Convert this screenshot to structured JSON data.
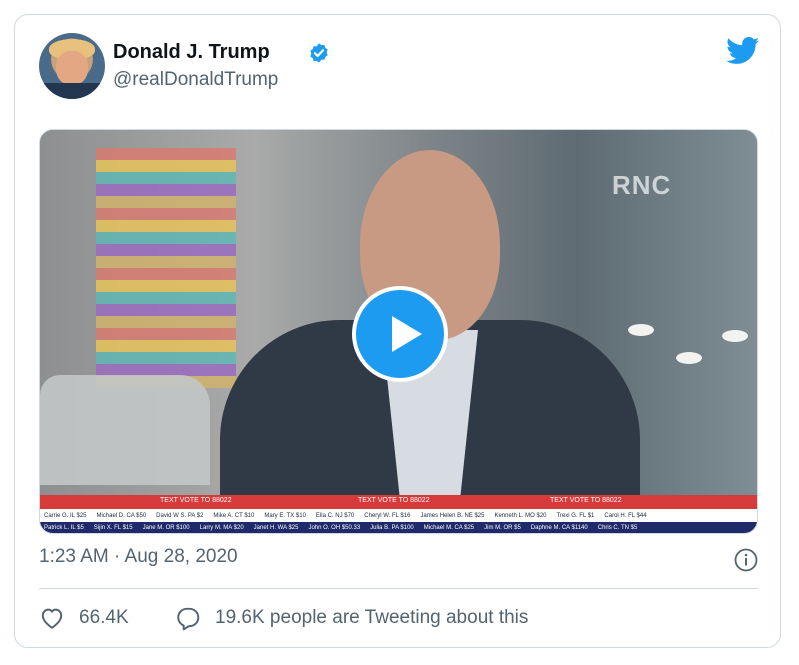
{
  "author": {
    "name": "Donald J. Trump",
    "handle": "@realDonaldTrump"
  },
  "icons": {
    "verified": "verified-badge-icon",
    "brand": "twitter-bird-icon",
    "play": "play-icon",
    "info": "info-icon",
    "like": "heart-icon",
    "reply": "speech-bubble-icon"
  },
  "media": {
    "watermark": "RNC",
    "ticker_banner": [
      "TEXT VOTE TO 88022",
      "TEXT VOTE TO 88022",
      "TEXT VOTE TO 88022"
    ],
    "ticker_row1": [
      "Carrie G. IL $25",
      "Michael D. CA $50",
      "David W S. PA $2",
      "Mike A. CT $10",
      "Mary E. TX $10",
      "Ella C. NJ $70",
      "Cheryl W. FL $16",
      "James Helen B. NE $25",
      "Kenneth L. MO $20",
      "Trexi G. FL $1",
      "Carol H. FL $44"
    ],
    "ticker_row2": [
      "Patrick L. IL $5",
      "Sijin X. FL $15",
      "Jane M. OR $100",
      "Larry M. MA $20",
      "Janet H. WA $25",
      "John O. OH $50.33",
      "Julia B. PA $100",
      "Michael M. CA $25",
      "Jim M. OR $5",
      "Daphne M. CA $1140",
      "Chris C. TN $5"
    ]
  },
  "timestamp": "1:23 AM · Aug 28, 2020",
  "stats": {
    "likes": "66.4K",
    "tweeting": "19.6K people are Tweeting about this"
  },
  "colors": {
    "accent": "#1d9bf0",
    "muted_text": "#536471",
    "border": "#cfd9de"
  }
}
